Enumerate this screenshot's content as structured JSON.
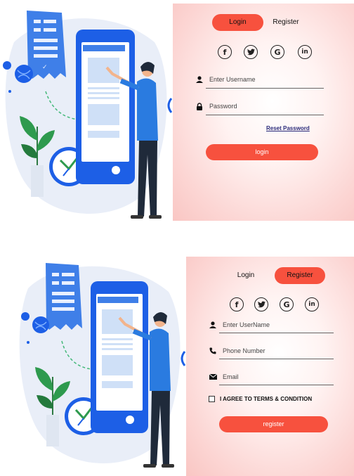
{
  "login_form": {
    "tab_login": "Login",
    "tab_register": "Register",
    "username_placeholder": "Enter Username",
    "password_placeholder": "Password",
    "reset_link": "Reset Password",
    "submit_label": "login",
    "active_tab": "login"
  },
  "register_form": {
    "tab_login": "Login",
    "tab_register": "Register",
    "username_placeholder": "Enter UserName",
    "phone_placeholder": "Phone Number",
    "email_placeholder": "Email",
    "agree_label": "I AGREE TO TERMS & CONDITION",
    "submit_label": "register",
    "active_tab": "register"
  },
  "socials": [
    {
      "icon": "facebook-icon",
      "glyph": "f"
    },
    {
      "icon": "twitter-icon",
      "glyph": "t"
    },
    {
      "icon": "google-icon",
      "glyph": "G"
    },
    {
      "icon": "linkedin-icon",
      "glyph": "in"
    }
  ],
  "colors": {
    "accent": "#f7513e",
    "phone_blue": "#1d5fe6",
    "shirt_blue": "#2a7be0",
    "pants": "#1f2a3a",
    "plant_green": "#2e9a4e"
  }
}
